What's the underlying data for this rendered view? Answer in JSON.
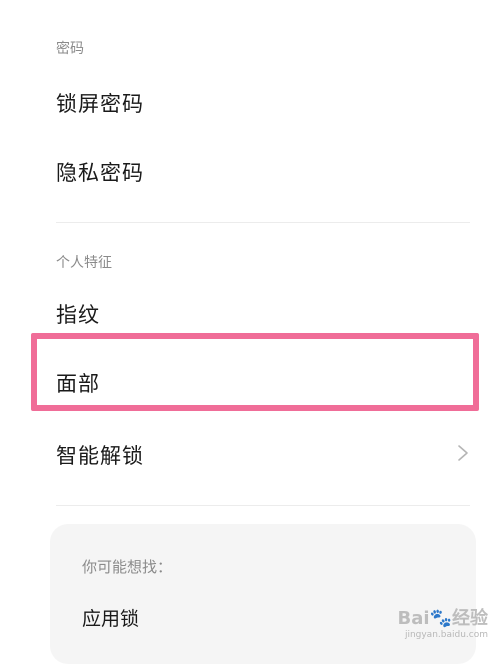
{
  "sections": {
    "password": {
      "header": "密码",
      "items": [
        "锁屏密码",
        "隐私密码"
      ]
    },
    "biometrics": {
      "header": "个人特征",
      "items": [
        "指纹",
        "面部",
        "智能解锁"
      ]
    }
  },
  "suggestions": {
    "title": "你可能想找：",
    "items": [
      "应用锁"
    ]
  },
  "highlight": {
    "target": "面部",
    "color": "#f06d98"
  },
  "icons": {
    "smart_unlock_chevron": "chevron-right-icon"
  },
  "watermark": {
    "main": "Bai🐾经验",
    "sub": "jingyan.baidu.com"
  }
}
